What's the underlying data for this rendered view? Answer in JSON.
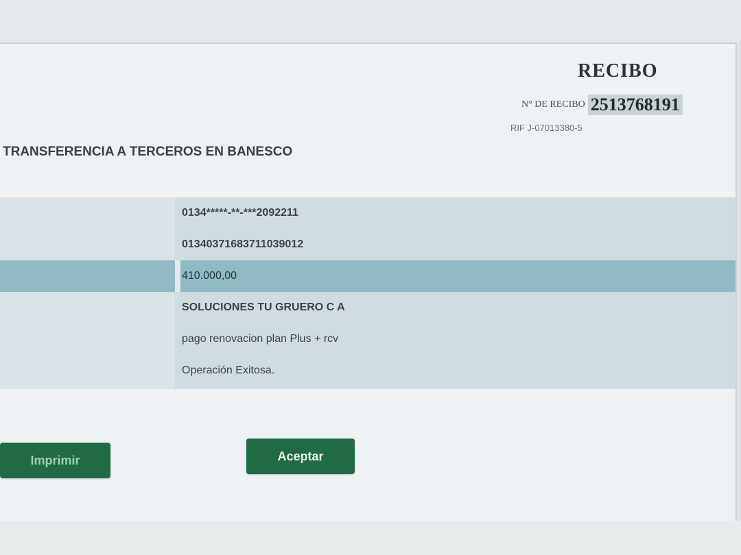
{
  "receipt": {
    "title": "RECIBO",
    "number_label": "N° DE RECIBO",
    "number": "2513768191",
    "rif": "RIF J-07013380-5"
  },
  "operation": {
    "title": "TRANSFERENCIA A TERCEROS EN BANESCO"
  },
  "details": {
    "source_account": "0134*****-**-***2092211",
    "destination_account": "01340371683711039012",
    "amount": "410.000,00",
    "beneficiary": "SOLUCIONES TU GRUERO C A",
    "concept": "pago renovacion plan Plus + rcv",
    "status": "Operación Exitosa."
  },
  "buttons": {
    "print": "Imprimir",
    "accept": "Aceptar"
  },
  "colors": {
    "button_green": "#216b44",
    "amount_row_blue": "#8fbac6"
  }
}
